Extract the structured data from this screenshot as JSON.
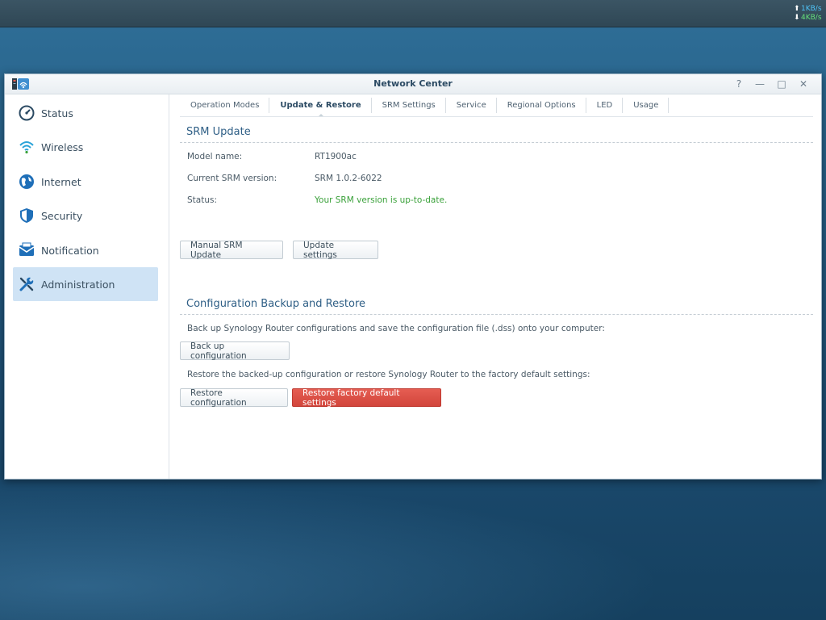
{
  "taskbar": {
    "upload_speed": "1KB/s",
    "download_speed": "4KB/s"
  },
  "window": {
    "title": "Network Center",
    "controls": [
      "?",
      "—",
      "□",
      "✕"
    ]
  },
  "sidebar": {
    "items": [
      {
        "label": "Status",
        "icon": "gauge-icon"
      },
      {
        "label": "Wireless",
        "icon": "wifi-icon"
      },
      {
        "label": "Internet",
        "icon": "globe-icon"
      },
      {
        "label": "Security",
        "icon": "shield-icon"
      },
      {
        "label": "Notification",
        "icon": "mail-icon"
      },
      {
        "label": "Administration",
        "icon": "tools-icon",
        "active": true
      }
    ]
  },
  "tabs": [
    {
      "label": "Operation Modes"
    },
    {
      "label": "Update & Restore",
      "active": true
    },
    {
      "label": "SRM Settings"
    },
    {
      "label": "Service"
    },
    {
      "label": "Regional Options"
    },
    {
      "label": "LED"
    },
    {
      "label": "Usage"
    }
  ],
  "srm_update": {
    "title": "SRM Update",
    "model_label": "Model name:",
    "model_value": "RT1900ac",
    "version_label": "Current SRM version:",
    "version_value": "SRM 1.0.2-6022",
    "status_label": "Status:",
    "status_value": "Your SRM version is up-to-date.",
    "manual_update_btn": "Manual SRM Update",
    "update_settings_btn": "Update settings"
  },
  "backup": {
    "title": "Configuration Backup and Restore",
    "backup_text": "Back up Synology Router configurations and save the configuration file (.dss) onto your computer:",
    "backup_btn": "Back up configuration",
    "restore_text": "Restore the backed-up configuration or restore Synology Router to the factory default settings:",
    "restore_btn": "Restore configuration",
    "factory_btn": "Restore factory default settings"
  },
  "colors": {
    "accent": "#2f5f86",
    "ok": "#3aa13a",
    "danger": "#d2453b",
    "active_bg": "#cfe3f5"
  }
}
